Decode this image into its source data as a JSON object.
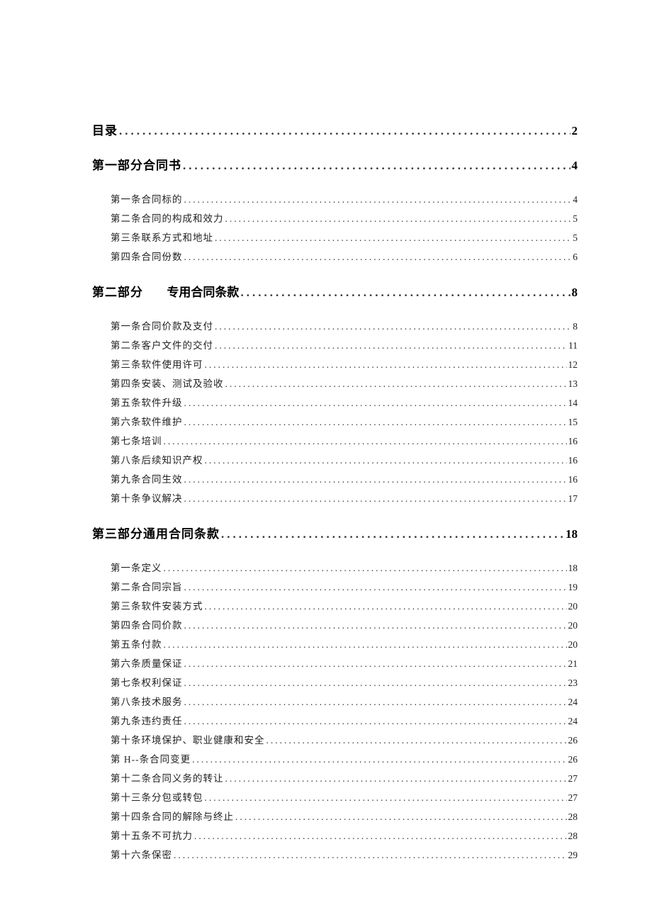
{
  "toc": [
    {
      "level": 1,
      "label": "目录",
      "page": "2"
    },
    {
      "level": 1,
      "label": "第一部分合同书",
      "page": "4"
    },
    {
      "level": 2,
      "label": "第一条合同标的",
      "page": "4"
    },
    {
      "level": 2,
      "label": "第二条合同的构成和效力",
      "page": "5"
    },
    {
      "level": 2,
      "label": "第三条联系方式和地址",
      "page": "5"
    },
    {
      "level": 2,
      "label": "第四条合同份数",
      "page": "6"
    },
    {
      "level": 1,
      "label_a": "第二部分",
      "label_b": "专用合同条款",
      "page": "8",
      "split": true
    },
    {
      "level": 2,
      "label": "第一条合同价款及支付",
      "page": "8"
    },
    {
      "level": 2,
      "label": "第二条客户文件的交付",
      "page": "11"
    },
    {
      "level": 2,
      "label": "第三条软件使用许可",
      "page": "12"
    },
    {
      "level": 2,
      "label": "第四条安装、测试及验收",
      "page": "13"
    },
    {
      "level": 2,
      "label": "第五条软件升级",
      "page": "14"
    },
    {
      "level": 2,
      "label": "第六条软件维护",
      "page": "15"
    },
    {
      "level": 2,
      "label": "第七条培训",
      "page": "16"
    },
    {
      "level": 2,
      "label": "第八条后续知识产权",
      "page": "16"
    },
    {
      "level": 2,
      "label": "第九条合同生效",
      "page": "16"
    },
    {
      "level": 2,
      "label": "第十条争议解决",
      "page": "17"
    },
    {
      "level": 1,
      "label": "第三部分通用合同条款",
      "page": "18"
    },
    {
      "level": 2,
      "label": "第一条定义",
      "page": "18"
    },
    {
      "level": 2,
      "label": "第二条合同宗旨",
      "page": "19"
    },
    {
      "level": 2,
      "label": "第三条软件安装方式",
      "page": "20"
    },
    {
      "level": 2,
      "label": "第四条合同价款",
      "page": "20"
    },
    {
      "level": 2,
      "label": "第五条付款",
      "page": "20"
    },
    {
      "level": 2,
      "label": "第六条质量保证",
      "page": "21"
    },
    {
      "level": 2,
      "label": "第七条权利保证",
      "page": "23"
    },
    {
      "level": 2,
      "label": "第八条技术服务",
      "page": "24"
    },
    {
      "level": 2,
      "label": "第九条违约责任",
      "page": "24"
    },
    {
      "level": 2,
      "label": "第十条环境保护、职业健康和安全",
      "page": "26"
    },
    {
      "level": 2,
      "label": "第 H--条合同变更",
      "page": "26"
    },
    {
      "level": 2,
      "label": "第十二条合同义务的转让",
      "page": "27"
    },
    {
      "level": 2,
      "label": "第十三条分包或转包",
      "page": "27"
    },
    {
      "level": 2,
      "label": "第十四条合同的解除与终止",
      "page": "28"
    },
    {
      "level": 2,
      "label": "第十五条不可抗力",
      "page": "28"
    },
    {
      "level": 2,
      "label": "第十六条保密",
      "page": "29"
    }
  ],
  "groups": [
    {
      "start": 0,
      "end": 1
    },
    {
      "start": 1,
      "end": 6
    },
    {
      "start": 6,
      "end": 17
    },
    {
      "start": 17,
      "end": 34
    }
  ],
  "dots_h1": "..............................................................................................",
  "dots_h2": ".............................................................................................................................."
}
